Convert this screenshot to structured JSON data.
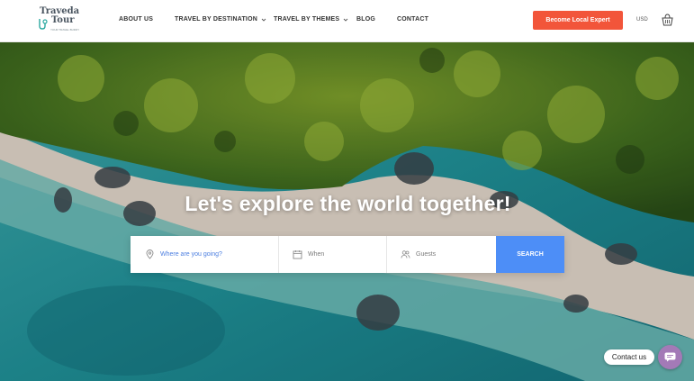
{
  "brand": {
    "name_line1": "Traveda",
    "name_line2": "Tour",
    "tagline": "YOUR TRAVEL BUDDY"
  },
  "nav": {
    "about": "ABOUT US",
    "destination": "TRAVEL BY DESTINATION",
    "themes": "TRAVEL BY THEMES",
    "blog": "BLOG",
    "contact": "CONTACT"
  },
  "header": {
    "cta_label": "Become Local Expert",
    "currency": "USD"
  },
  "hero": {
    "title": "Let's explore the world together!"
  },
  "search": {
    "where_placeholder": "Where are you going?",
    "when_placeholder": "When",
    "guests_placeholder": "Guests",
    "button_label": "SEARCH"
  },
  "chat": {
    "label": "Contact us"
  },
  "colors": {
    "accent": "#f2553a",
    "search_button": "#4d8ef7",
    "chat": "#a37ab7"
  }
}
